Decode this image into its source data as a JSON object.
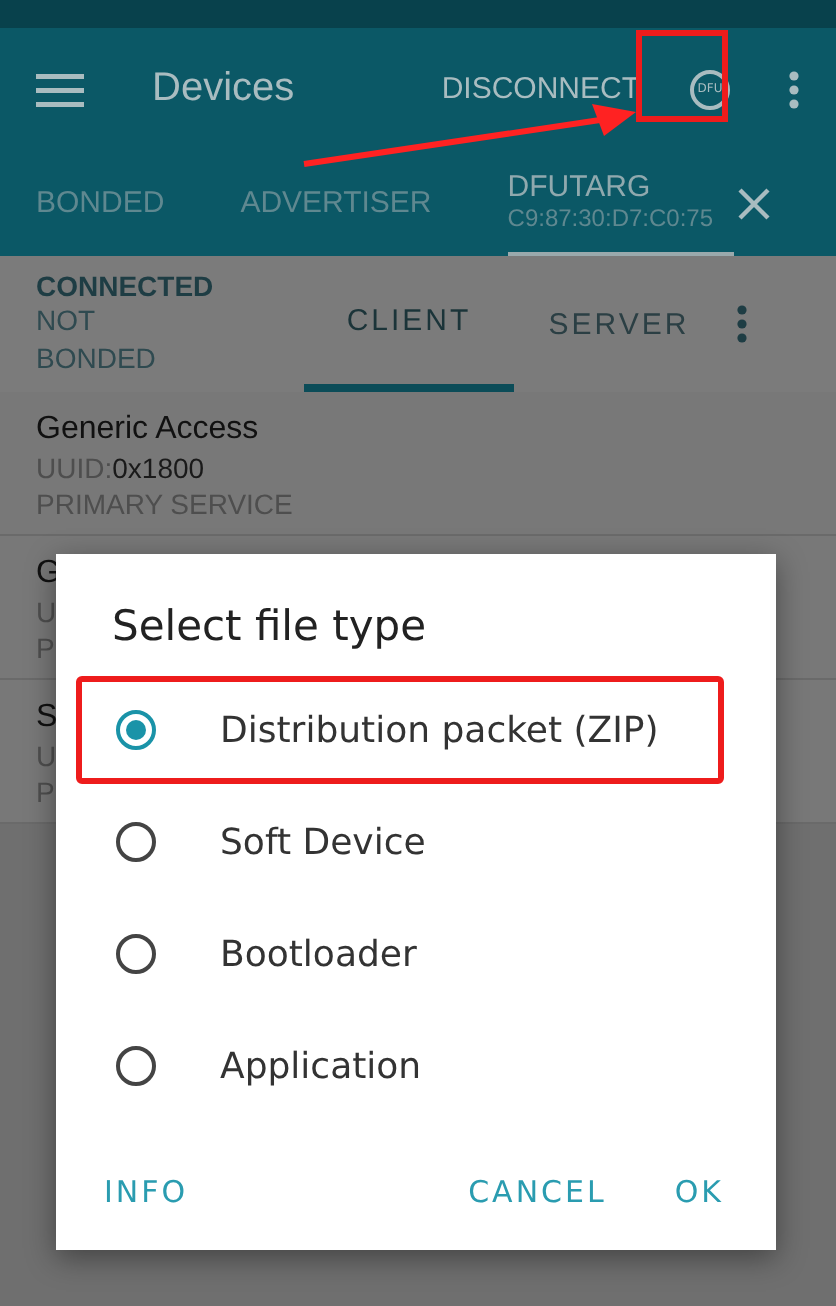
{
  "app_bar": {
    "title": "Devices",
    "action": "DISCONNECT",
    "dfu_label": "DFU"
  },
  "device_tabs": [
    {
      "label": "BONDED",
      "selected": false
    },
    {
      "label": "ADVERTISER",
      "selected": false
    },
    {
      "label": "DFUTARG",
      "subtitle": "C9:87:30:D7:C0:75",
      "selected": true
    }
  ],
  "connection": {
    "state": "CONNECTED",
    "bond": "NOT\nBONDED"
  },
  "mode_tabs": [
    {
      "label": "CLIENT",
      "selected": true
    },
    {
      "label": "SERVER",
      "selected": false
    }
  ],
  "services": [
    {
      "name": "Generic Access",
      "uuid_label": "UUID:",
      "uuid": "0x1800",
      "type": "PRIMARY SERVICE"
    },
    {
      "name": "G",
      "uuid_label": "U",
      "type": "P"
    },
    {
      "name": "S",
      "uuid_label": "U",
      "type": "P"
    }
  ],
  "dialog": {
    "title": "Select file type",
    "options": [
      {
        "label": "Distribution packet (ZIP)",
        "selected": true
      },
      {
        "label": "Soft Device",
        "selected": false
      },
      {
        "label": "Bootloader",
        "selected": false
      },
      {
        "label": "Application",
        "selected": false
      }
    ],
    "buttons": [
      "INFO",
      "CANCEL",
      "OK"
    ]
  }
}
